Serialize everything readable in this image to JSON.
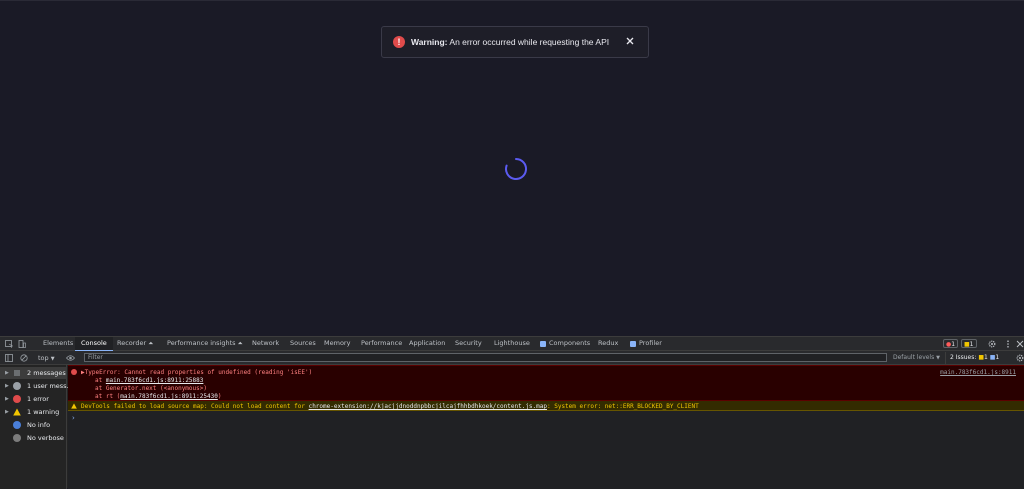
{
  "toast": {
    "title": "Warning:",
    "message": "An error occurred while requesting the API"
  },
  "devtools": {
    "tabs": [
      {
        "label": "Elements"
      },
      {
        "label": "Console"
      },
      {
        "label": "Recorder ⏶"
      },
      {
        "label": "Performance insights ⏶"
      },
      {
        "label": "Network"
      },
      {
        "label": "Sources"
      },
      {
        "label": "Memory"
      },
      {
        "label": "Performance"
      },
      {
        "label": "Application"
      },
      {
        "label": "Security"
      },
      {
        "label": "Lighthouse"
      },
      {
        "label": "Components"
      },
      {
        "label": "Redux"
      },
      {
        "label": "Profiler"
      }
    ],
    "error_count": "1",
    "warning_count": "1",
    "context": "top",
    "filter_placeholder": "Filter",
    "levels": "Default levels",
    "issues_label": "2 Issues:",
    "issues_warn": "1",
    "issues_info": "1",
    "sidebar": [
      {
        "label": "2 messages"
      },
      {
        "label": "1 user mess..."
      },
      {
        "label": "1 error"
      },
      {
        "label": "1 warning"
      },
      {
        "label": "No info"
      },
      {
        "label": "No verbose"
      }
    ],
    "error": {
      "message": "TypeError: Cannot read properties of undefined (reading 'isEE')",
      "source": "main.783f6cd1.js:8911",
      "stack": [
        {
          "prefix": "at ",
          "link": "main.783f6cd1.js:8911:25883",
          "suffix": ""
        },
        {
          "prefix": "at Generator.next (<anonymous>)",
          "link": "",
          "suffix": ""
        },
        {
          "prefix": "at rt (",
          "link": "main.783f6cd1.js:8911:25430",
          "suffix": ")"
        }
      ]
    },
    "warning": {
      "prefix": "DevTools failed to load source map: Could not load content for ",
      "link": "chrome-extension://kjacjjdnoddnpbbcjilcajfhhbdhkoek/content.js.map",
      "suffix": ": System error: net::ERR_BLOCKED_BY_CLIENT"
    },
    "prompt": "›"
  },
  "colors": {
    "app_bg": "#1a1a26",
    "spinner": "#5b5bf0",
    "error_red": "#e04b4b",
    "console_error_bg": "#290000",
    "console_warn_bg": "#332b00"
  }
}
